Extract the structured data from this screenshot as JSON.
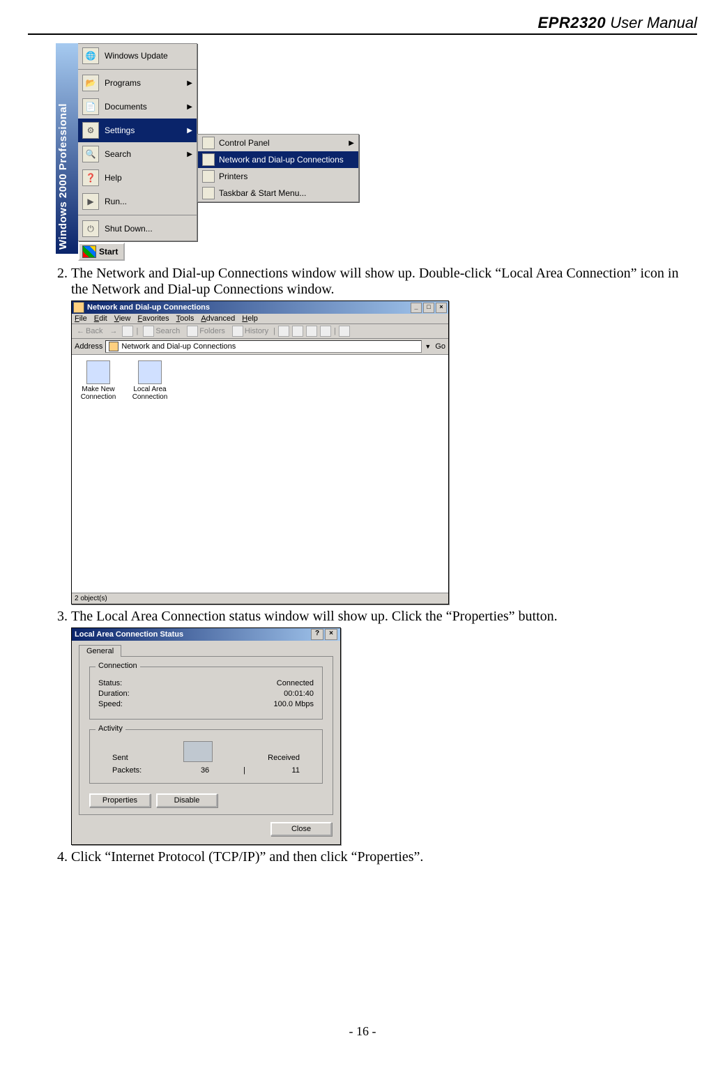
{
  "header": {
    "model": "EPR2320",
    "suffix": " User Manual"
  },
  "footer": {
    "page": "- 16 -"
  },
  "steps": {
    "start_index": 2,
    "s2": "The Network and Dial-up Connections window will show up. Double-click “Local Area Connection” icon in the Network and Dial-up Connections window.",
    "s3": "The Local Area Connection status window will show up. Click the “Properties” button.",
    "s4": "Click “Internet Protocol (TCP/IP)” and then click “Properties”."
  },
  "startmenu": {
    "band": "Windows 2000 Professional",
    "items": [
      "Windows Update",
      "Programs",
      "Documents",
      "Settings",
      "Search",
      "Help",
      "Run...",
      "Shut Down..."
    ],
    "settings_sub": [
      "Control Panel",
      "Network and Dial-up Connections",
      "Printers",
      "Taskbar & Start Menu..."
    ],
    "start_label": "Start"
  },
  "explorer": {
    "title": "Network and Dial-up Connections",
    "menus": [
      "File",
      "Edit",
      "View",
      "Favorites",
      "Tools",
      "Advanced",
      "Help"
    ],
    "toolbar": {
      "back": "Back",
      "search": "Search",
      "folders": "Folders",
      "history": "History"
    },
    "address_label": "Address",
    "address_value": "Network and Dial-up Connections",
    "go": "Go",
    "icons": [
      {
        "label": "Make New Connection"
      },
      {
        "label": "Local Area Connection"
      }
    ],
    "status": "2 object(s)"
  },
  "status_dlg": {
    "title": "Local Area Connection Status",
    "tab": "General",
    "connection": {
      "legend": "Connection",
      "status_l": "Status:",
      "status_v": "Connected",
      "duration_l": "Duration:",
      "duration_v": "00:01:40",
      "speed_l": "Speed:",
      "speed_v": "100.0 Mbps"
    },
    "activity": {
      "legend": "Activity",
      "sent": "Sent",
      "received": "Received",
      "packets_l": "Packets:",
      "sent_v": "36",
      "recv_v": "11"
    },
    "buttons": {
      "properties": "Properties",
      "disable": "Disable",
      "close": "Close"
    }
  }
}
